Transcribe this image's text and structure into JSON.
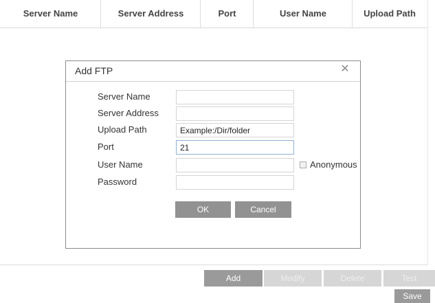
{
  "table": {
    "columns": [
      "Server Name",
      "Server Address",
      "Port",
      "User Name",
      "Upload Path"
    ]
  },
  "dialog": {
    "title": "Add FTP",
    "close_icon": "close-icon",
    "fields": {
      "server_name": {
        "label": "Server Name",
        "value": ""
      },
      "server_address": {
        "label": "Server Address",
        "value": ""
      },
      "upload_path": {
        "label": "Upload Path",
        "value": "Example:/Dir/folder"
      },
      "port": {
        "label": "Port",
        "value": "21"
      },
      "user_name": {
        "label": "User Name",
        "value": ""
      },
      "password": {
        "label": "Password",
        "value": ""
      }
    },
    "anonymous_label": "Anonymous",
    "ok_label": "OK",
    "cancel_label": "Cancel"
  },
  "actions": {
    "add": "Add",
    "modify": "Modify",
    "delete": "Delete",
    "test": "Test",
    "save": "Save"
  },
  "colors": {
    "button_enabled": "#9a9a9a",
    "button_disabled": "#d6d6d6",
    "dialog_border": "#8a8a8a"
  }
}
